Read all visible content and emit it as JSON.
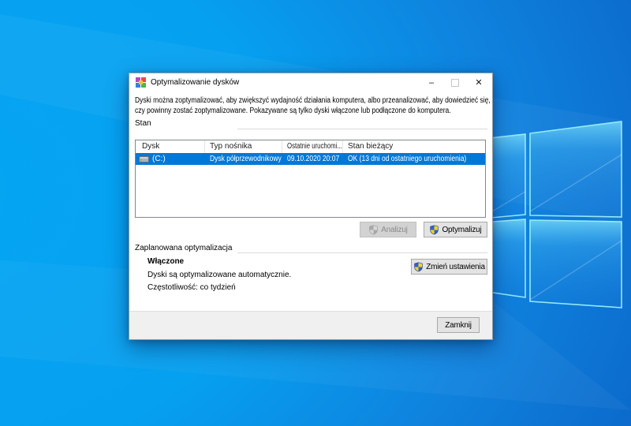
{
  "window": {
    "title": "Optymalizowanie dysków",
    "minimize_glyph": "–",
    "close_glyph": "✕"
  },
  "intro": {
    "line1": "Dyski można zoptymalizować, aby zwiększyć wydajność działania komputera, albo przeanalizować, aby dowiedzieć się,",
    "line2": "czy powinny zostać zoptymalizowane. Pokazywane są tylko dyski włączone lub podłączone do komputera."
  },
  "status": {
    "label": "Stan",
    "columns": [
      "Dysk",
      "Typ nośnika",
      "Ostatnie uruchomi...",
      "Stan bieżący"
    ],
    "row": {
      "disk": "(C:)",
      "media_type": "Dysk półprzewodnikowy",
      "last_run": "09.10.2020 20:07",
      "current_state": "OK (13 dni od ostatniego uruchomienia)"
    },
    "analyze_label": "Analizuj",
    "optimize_label": "Optymalizuj"
  },
  "schedule": {
    "label": "Zaplanowana optymalizacja",
    "state": "Włączone",
    "description": "Dyski są optymalizowane automatycznie.",
    "frequency": "Częstotliwość: co tydzień",
    "change_label": "Zmień ustawienia"
  },
  "footer": {
    "close_label": "Zamknij"
  },
  "colors": {
    "selection": "#0078d7",
    "shield_blue": "#2a62d8",
    "shield_yellow": "#fbd51a",
    "wallpaper_azure": "#06a0f0",
    "wallpaper_deep": "#0a5dbe"
  }
}
